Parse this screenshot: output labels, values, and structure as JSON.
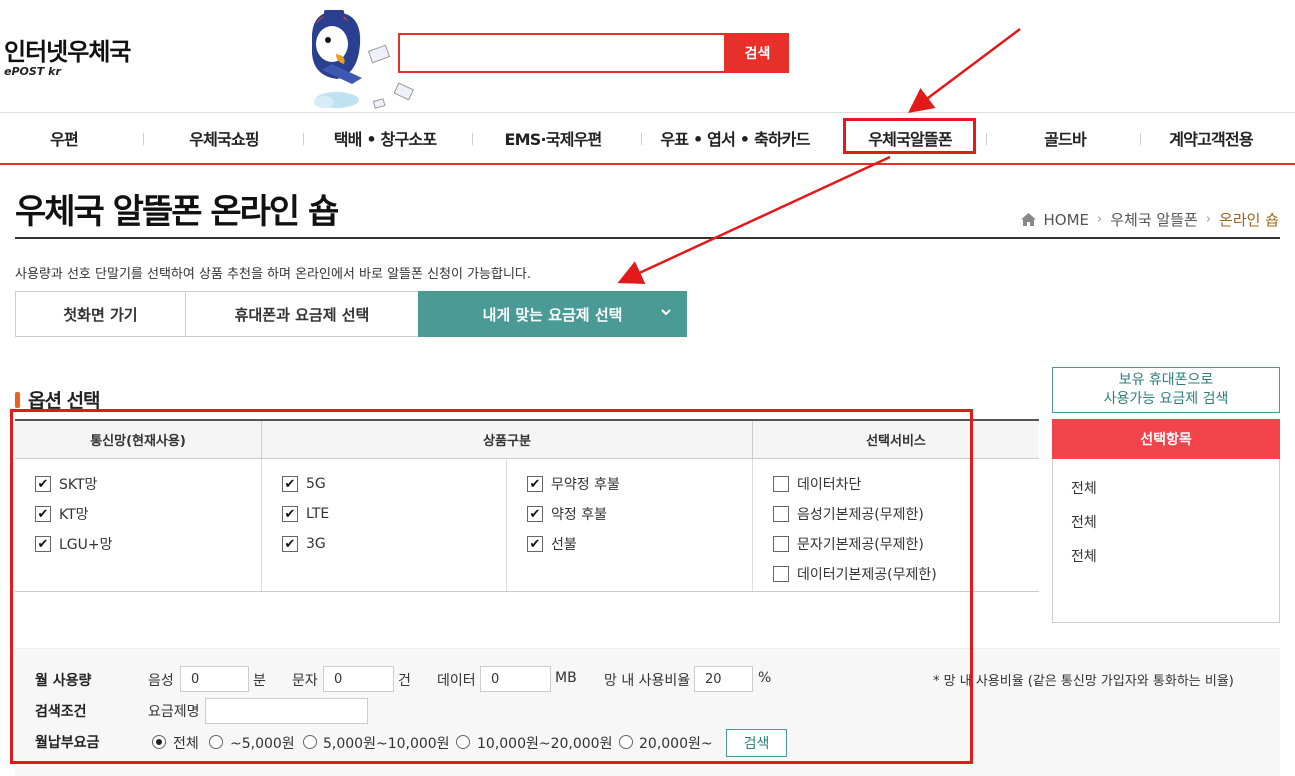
{
  "header": {
    "logo_main": "인터넷우체국",
    "logo_sub": "ePOST kr",
    "search_placeholder": "",
    "search_button": "검색"
  },
  "gnb": {
    "items": [
      "우편",
      "우체국쇼핑",
      "택배 • 창구소포",
      "EMS·국제우편",
      "우표 • 엽서 • 축하카드",
      "우체국알뜰폰",
      "골드바",
      "계약고객전용"
    ]
  },
  "page": {
    "title": "우체국 알뜰폰 온라인 숍",
    "breadcrumb": [
      "HOME",
      "우체국 알뜰폰",
      "온라인 숍"
    ],
    "description": "사용량과 선호 단말기를 선택하여 상품 추천을 하며 온라인에서 바로 알뜰폰 신청이 가능합니다."
  },
  "tabs": [
    "첫화면 가기",
    "휴대폰과 요금제 선택",
    "내게 맞는 요금제 선택"
  ],
  "options": {
    "section_title": "옵션 선택",
    "headers": [
      "통신망(현재사용)",
      "상품구분",
      "선택서비스"
    ],
    "network": [
      {
        "label": "SKT망",
        "checked": true
      },
      {
        "label": "KT망",
        "checked": true
      },
      {
        "label": "LGU+망",
        "checked": true
      }
    ],
    "generation": [
      {
        "label": "5G",
        "checked": true
      },
      {
        "label": "LTE",
        "checked": true
      },
      {
        "label": "3G",
        "checked": true
      }
    ],
    "contract": [
      {
        "label": "무약정 후불",
        "checked": true
      },
      {
        "label": "약정 후불",
        "checked": true
      },
      {
        "label": "선불",
        "checked": true
      }
    ],
    "services": [
      {
        "label": "데이터차단",
        "checked": false
      },
      {
        "label": "음성기본제공(무제한)",
        "checked": false
      },
      {
        "label": "문자기본제공(무제한)",
        "checked": false
      },
      {
        "label": "데이터기본제공(무제한)",
        "checked": false
      }
    ]
  },
  "side": {
    "owned_phone_line1": "보유 휴대폰으로",
    "owned_phone_line2": "사용가능 요금제 검색",
    "selected_header": "선택항목",
    "selected_items": [
      "전체",
      "전체",
      "전체"
    ]
  },
  "filter": {
    "monthly_usage_label": "월 사용량",
    "voice_label": "음성",
    "voice_value": "0",
    "voice_unit": "분",
    "sms_label": "문자",
    "sms_value": "0",
    "sms_unit": "건",
    "data_label": "데이터",
    "data_value": "0",
    "data_unit": "MB",
    "ratio_label": "망 내 사용비율",
    "ratio_value": "20",
    "ratio_unit": "%",
    "ratio_note": "* 망 내 사용비율 (같은 통신망 가입자와 통화하는 비율)",
    "condition_label": "검색조건",
    "plan_name_label": "요금제명",
    "plan_name_value": "",
    "fee_label": "월납부요금",
    "fee_options": [
      "전체",
      "~5,000원",
      "5,000원~10,000원",
      "10,000원~20,000원",
      "20,000원~"
    ],
    "fee_selected": "전체",
    "search_button": "검색"
  },
  "colors": {
    "accent_red": "#e8302a",
    "teal": "#4a9a96",
    "annotation_red": "#e41a1a"
  }
}
